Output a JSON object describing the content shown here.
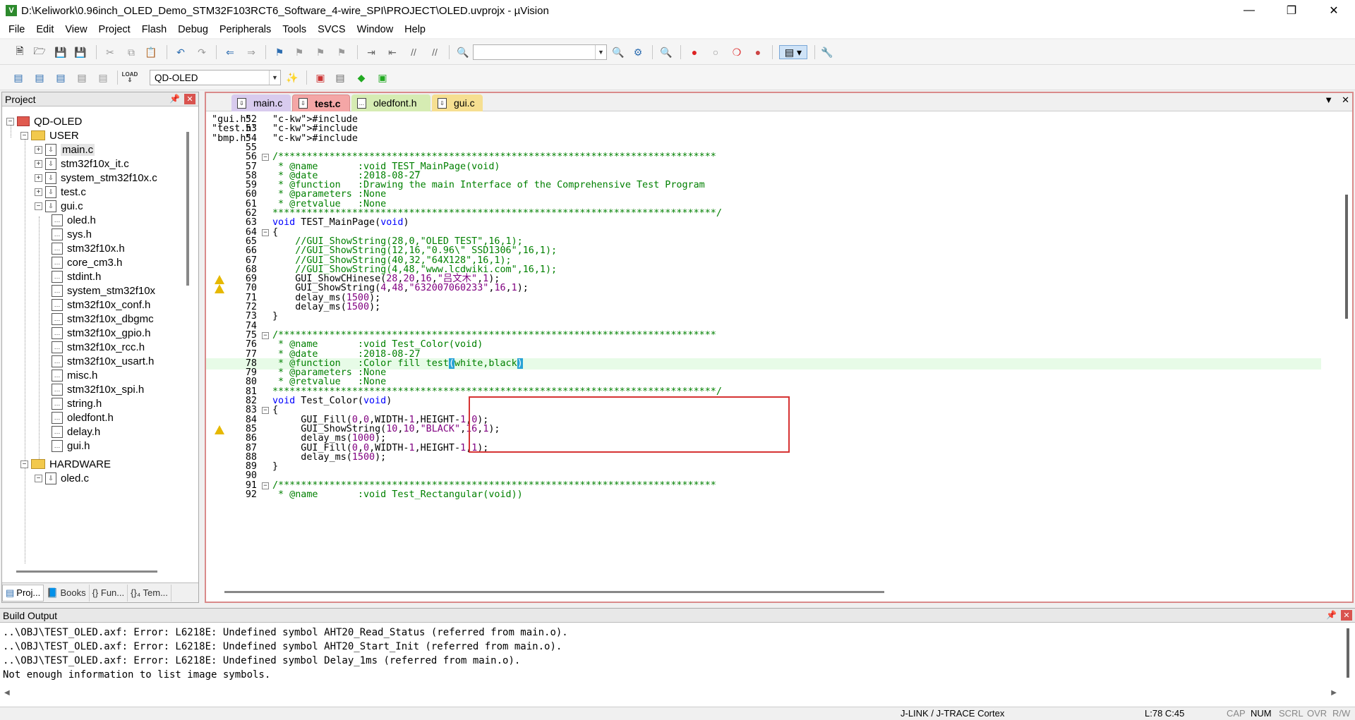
{
  "window": {
    "title": "D:\\Keliwork\\0.96inch_OLED_Demo_STM32F103RCT6_Software_4-wire_SPI\\PROJECT\\OLED.uvprojx - µVision",
    "app_icon": "V"
  },
  "menu": [
    "File",
    "Edit",
    "View",
    "Project",
    "Flash",
    "Debug",
    "Peripherals",
    "Tools",
    "SVCS",
    "Window",
    "Help"
  ],
  "toolbar2": {
    "target": "QD-OLED",
    "load_label": "LOAD"
  },
  "project_pane": {
    "title": "Project",
    "tree": [
      {
        "label": "QD-OLED",
        "kind": "target"
      },
      {
        "label": "USER",
        "kind": "folder"
      },
      {
        "label": "main.c",
        "kind": "file"
      },
      {
        "label": "stm32f10x_it.c",
        "kind": "file"
      },
      {
        "label": "system_stm32f10x.c",
        "kind": "file"
      },
      {
        "label": "test.c",
        "kind": "file"
      },
      {
        "label": "gui.c",
        "kind": "file"
      },
      {
        "label": "oled.h",
        "kind": "header"
      },
      {
        "label": "sys.h",
        "kind": "header"
      },
      {
        "label": "stm32f10x.h",
        "kind": "header"
      },
      {
        "label": "core_cm3.h",
        "kind": "header"
      },
      {
        "label": "stdint.h",
        "kind": "header"
      },
      {
        "label": "system_stm32f10x",
        "kind": "header"
      },
      {
        "label": "stm32f10x_conf.h",
        "kind": "header"
      },
      {
        "label": "stm32f10x_dbgmc",
        "kind": "header"
      },
      {
        "label": "stm32f10x_gpio.h",
        "kind": "header"
      },
      {
        "label": "stm32f10x_rcc.h",
        "kind": "header"
      },
      {
        "label": "stm32f10x_usart.h",
        "kind": "header"
      },
      {
        "label": "misc.h",
        "kind": "header"
      },
      {
        "label": "stm32f10x_spi.h",
        "kind": "header"
      },
      {
        "label": "string.h",
        "kind": "header"
      },
      {
        "label": "oledfont.h",
        "kind": "header"
      },
      {
        "label": "delay.h",
        "kind": "header"
      },
      {
        "label": "gui.h",
        "kind": "header"
      },
      {
        "label": "HARDWARE",
        "kind": "folder"
      },
      {
        "label": "oled.c",
        "kind": "file"
      }
    ],
    "bottom_tabs": [
      "Proj...",
      "Books",
      "{} Fun...",
      "{}₄ Tem..."
    ]
  },
  "editor": {
    "tabs": [
      {
        "label": "main.c",
        "color": "#c9b8e8"
      },
      {
        "label": "test.c",
        "color": "#f4a6a6"
      },
      {
        "label": "oledfont.h",
        "color": "#cfe8a9"
      },
      {
        "label": "gui.c",
        "color": "#f4dc8c"
      }
    ],
    "lines": [
      {
        "n": "52",
        "t": "#include \"gui.h\""
      },
      {
        "n": "53",
        "t": "#include \"test.h\""
      },
      {
        "n": "54",
        "t": "#include \"bmp.h\""
      },
      {
        "n": "55",
        "t": ""
      },
      {
        "n": "56",
        "t": "/*****************************************************************************",
        "fold": "-"
      },
      {
        "n": "57",
        "t": " * @name       :void TEST_MainPage(void)"
      },
      {
        "n": "58",
        "t": " * @date       :2018-08-27"
      },
      {
        "n": "59",
        "t": " * @function   :Drawing the main Interface of the Comprehensive Test Program"
      },
      {
        "n": "60",
        "t": " * @parameters :None"
      },
      {
        "n": "61",
        "t": " * @retvalue   :None"
      },
      {
        "n": "62",
        "t": "******************************************************************************/"
      },
      {
        "n": "63",
        "t": "void TEST_MainPage(void)"
      },
      {
        "n": "64",
        "t": "{",
        "fold": "-"
      },
      {
        "n": "65",
        "t": "    //GUI_ShowString(28,0,\"OLED TEST\",16,1);"
      },
      {
        "n": "66",
        "t": "    //GUI_ShowString(12,16,\"0.96\\\" SSD1306\",16,1);"
      },
      {
        "n": "67",
        "t": "    //GUI_ShowString(40,32,\"64X128\",16,1);"
      },
      {
        "n": "68",
        "t": "    //GUI_ShowString(4,48,\"www.lcdwiki.com\",16,1);"
      },
      {
        "n": "69",
        "t": "    GUI_ShowCHinese(28,20,16,\"吕文木\",1);",
        "warn": true
      },
      {
        "n": "70",
        "t": "    GUI_ShowString(4,48,\"632007060233\",16,1);",
        "warn": true
      },
      {
        "n": "71",
        "t": "    delay_ms(1500);"
      },
      {
        "n": "72",
        "t": "    delay_ms(1500);"
      },
      {
        "n": "73",
        "t": "}"
      },
      {
        "n": "74",
        "t": ""
      },
      {
        "n": "75",
        "t": "/*****************************************************************************",
        "fold": "-"
      },
      {
        "n": "76",
        "t": " * @name       :void Test_Color(void)"
      },
      {
        "n": "77",
        "t": " * @date       :2018-08-27"
      },
      {
        "n": "78",
        "t": " * @function   :Color fill test(white,black)",
        "hl": true
      },
      {
        "n": "79",
        "t": " * @parameters :None"
      },
      {
        "n": "80",
        "t": " * @retvalue   :None"
      },
      {
        "n": "81",
        "t": "******************************************************************************/"
      },
      {
        "n": "82",
        "t": "void Test_Color(void)"
      },
      {
        "n": "83",
        "t": "{",
        "fold": "-"
      },
      {
        "n": "84",
        "t": "     GUI_Fill(0,0,WIDTH-1,HEIGHT-1,0);"
      },
      {
        "n": "85",
        "t": "     GUI_ShowString(10,10,\"BLACK\",16,1);",
        "warn": true
      },
      {
        "n": "86",
        "t": "     delay_ms(1000);"
      },
      {
        "n": "87",
        "t": "     GUI_Fill(0,0,WIDTH-1,HEIGHT-1,1);"
      },
      {
        "n": "88",
        "t": "     delay_ms(1500);"
      },
      {
        "n": "89",
        "t": "}"
      },
      {
        "n": "90",
        "t": ""
      },
      {
        "n": "91",
        "t": "/*****************************************************************************",
        "fold": "-"
      },
      {
        "n": "92",
        "t": " * @name       :void Test_Rectangular(void))"
      }
    ]
  },
  "build_output": {
    "title": "Build Output",
    "lines": [
      "..\\OBJ\\TEST_OLED.axf: Error: L6218E: Undefined symbol AHT20_Read_Status (referred from main.o).",
      "..\\OBJ\\TEST_OLED.axf: Error: L6218E: Undefined symbol AHT20_Start_Init (referred from main.o).",
      "..\\OBJ\\TEST_OLED.axf: Error: L6218E: Undefined symbol Delay_1ms (referred from main.o).",
      "Not enough information to list image symbols."
    ]
  },
  "statusbar": {
    "debugger": "J-LINK / J-TRACE Cortex",
    "position": "L:78 C:45",
    "caps": "CAP",
    "num": "NUM",
    "scrl": "SCRL",
    "ovr": "OVR",
    "rw": "R/W"
  }
}
